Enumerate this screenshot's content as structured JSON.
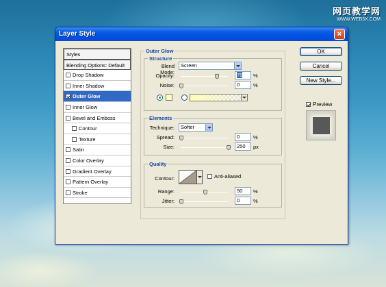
{
  "watermark": {
    "title": "网页教学网",
    "url": "WWW.WEB3X.COM"
  },
  "window": {
    "title": "Layer Style",
    "close_label": "×"
  },
  "styles_list": [
    {
      "label": "Styles",
      "type": "header",
      "checked": false
    },
    {
      "label": "Blending Options: Default",
      "type": "header",
      "checked": false
    },
    {
      "label": "Drop Shadow",
      "type": "item",
      "checked": false
    },
    {
      "label": "Inner Shadow",
      "type": "item",
      "checked": false
    },
    {
      "label": "Outer Glow",
      "type": "item",
      "checked": true,
      "selected": true
    },
    {
      "label": "Inner Glow",
      "type": "item",
      "checked": false
    },
    {
      "label": "Bevel and Emboss",
      "type": "item",
      "checked": false
    },
    {
      "label": "Contour",
      "type": "sub",
      "checked": false
    },
    {
      "label": "Texture",
      "type": "sub",
      "checked": false
    },
    {
      "label": "Satin",
      "type": "item",
      "checked": false
    },
    {
      "label": "Color Overlay",
      "type": "item",
      "checked": false
    },
    {
      "label": "Gradient Overlay",
      "type": "item",
      "checked": false
    },
    {
      "label": "Pattern Overlay",
      "type": "item",
      "checked": false
    },
    {
      "label": "Stroke",
      "type": "item",
      "checked": false
    }
  ],
  "outer_glow": {
    "title": "Outer Glow",
    "structure": {
      "title": "Structure",
      "blend_mode_label": "Blend Mode:",
      "blend_mode_value": "Screen",
      "opacity_label": "Opacity:",
      "opacity_value": "75",
      "opacity_unit": "%",
      "opacity_fraction": 0.75,
      "noise_label": "Noise:",
      "noise_value": "0",
      "noise_unit": "%",
      "noise_fraction": 0,
      "color": "#ffffbe",
      "gradient_color": "#ffffb9"
    },
    "elements": {
      "title": "Elements",
      "technique_label": "Technique:",
      "technique_value": "Softer",
      "spread_label": "Spread:",
      "spread_value": "0",
      "spread_unit": "%",
      "spread_fraction": 0,
      "size_label": "Size:",
      "size_value": "250",
      "size_unit": "px",
      "size_fraction": 1.0
    },
    "quality": {
      "title": "Quality",
      "contour_label": "Contour:",
      "anti_aliased_label": "Anti-aliased",
      "anti_aliased": false,
      "range_label": "Range:",
      "range_value": "50",
      "range_unit": "%",
      "range_fraction": 0.5,
      "jitter_label": "Jitter:",
      "jitter_value": "0",
      "jitter_unit": "%",
      "jitter_fraction": 0
    }
  },
  "buttons": {
    "ok": "OK",
    "cancel": "Cancel",
    "new_style": "New Style..."
  },
  "preview": {
    "label": "Preview",
    "checked": true
  }
}
